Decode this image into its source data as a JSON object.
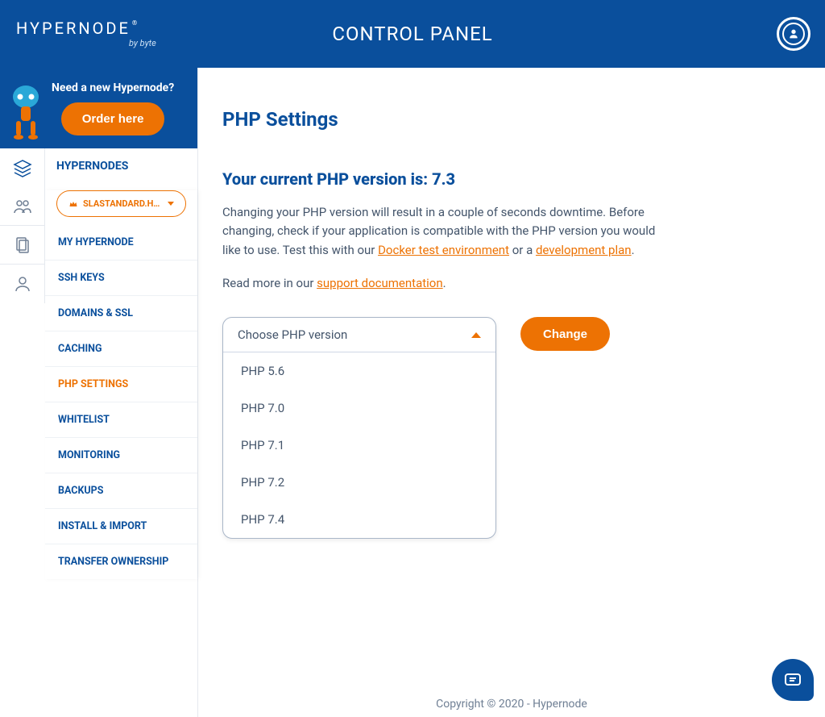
{
  "header": {
    "logo": "HYPERNODE",
    "logo_sub": "by byte",
    "title": "CONTROL PANEL"
  },
  "promo": {
    "question": "Need a new Hypernode?",
    "order_button": "Order here"
  },
  "nav": {
    "top": "HYPERNODES",
    "selector": "SLASTANDARD.HYPERN…",
    "items": [
      "MY HYPERNODE",
      "SSH KEYS",
      "DOMAINS & SSL",
      "CACHING",
      "PHP SETTINGS",
      "WHITELIST",
      "MONITORING",
      "BACKUPS",
      "INSTALL & IMPORT",
      "TRANSFER OWNERSHIP"
    ],
    "active_index": 4
  },
  "page": {
    "title": "PHP Settings",
    "card_title": "Your current PHP version is: 7.3",
    "para1_a": "Changing your PHP version will result in a couple of seconds downtime. Before changing, check if your application is compatible with the PHP version you would like to use. Test this with our ",
    "link_docker": "Docker test environment",
    "para1_b": " or a ",
    "link_devplan": "development plan",
    "para1_c": ".",
    "para2_a": "Read more in our ",
    "link_support": "support documentation",
    "para2_b": ".",
    "select_placeholder": "Choose PHP version",
    "options": [
      "PHP 5.6",
      "PHP 7.0",
      "PHP 7.1",
      "PHP 7.2",
      "PHP 7.4"
    ],
    "change_button": "Change"
  },
  "footer": "Copyright © 2020 - Hypernode"
}
